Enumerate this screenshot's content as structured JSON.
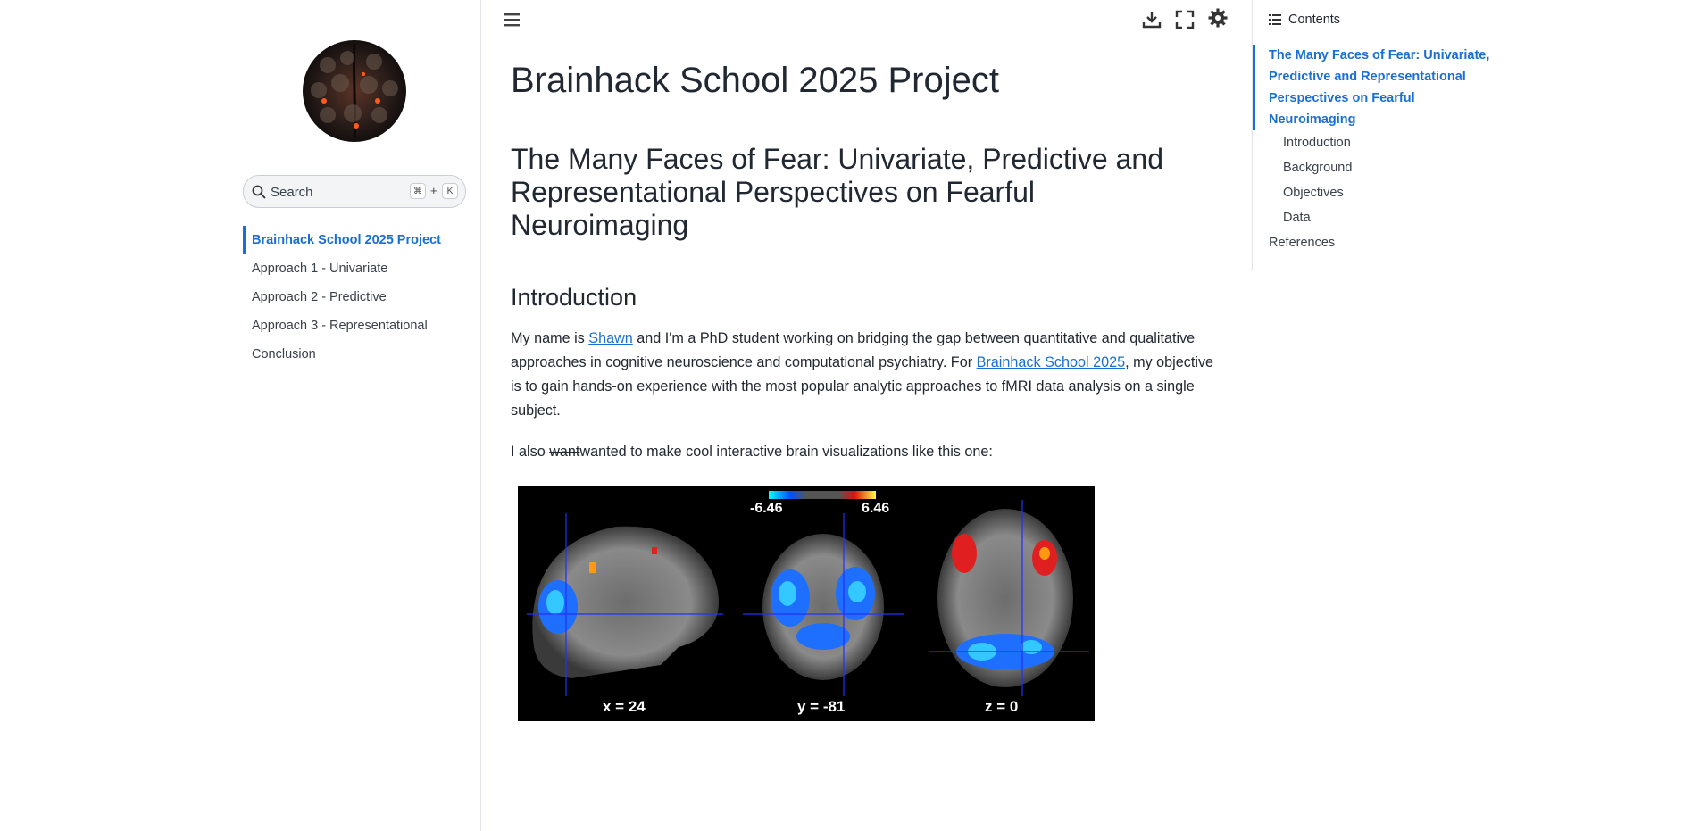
{
  "sidebar": {
    "search": {
      "placeholder": "Search",
      "shortcut_mod": "⌘",
      "shortcut_plus": "+",
      "shortcut_key": "K"
    },
    "items": [
      {
        "label": "Brainhack School 2025 Project",
        "active": true
      },
      {
        "label": "Approach 1 - Univariate"
      },
      {
        "label": "Approach 2 - Predictive"
      },
      {
        "label": "Approach 3 - Representational"
      },
      {
        "label": "Conclusion"
      }
    ]
  },
  "header": {
    "icons": [
      "menu-icon",
      "download-icon",
      "fullscreen-icon",
      "theme-gear-icon"
    ]
  },
  "main": {
    "title": "Brainhack School 2025 Project",
    "subtitle": "The Many Faces of Fear: Univariate, Predictive and Representational Perspectives on Fearful Neuroimaging",
    "intro_heading": "Introduction",
    "para1": {
      "t1": "My name is ",
      "link1": "Shawn",
      "t2": " and I'm a PhD student working on bridging the gap between quantitative and qualitative approaches in cognitive neuroscience and computational psychiatry. For ",
      "link2": "Brainhack School 2025",
      "t3": ", my objective is to gain hands-on experience with the most popular analytic approaches to fMRI data analysis on a single subject."
    },
    "para2": {
      "t1": "I also ",
      "strike": "want",
      "t2": "wanted to make cool interactive brain visualizations like this one:"
    },
    "figure": {
      "colorbar_min": "-6.46",
      "colorbar_max": "6.46",
      "captions": [
        "x = 24",
        "y = -81",
        "z = 0"
      ]
    }
  },
  "toc": {
    "heading": "Contents",
    "active": "The Many Faces of Fear: Univariate, Predictive and Representational Perspectives on Fearful Neuroimaging",
    "subitems": [
      "Introduction",
      "Background",
      "Objectives",
      "Data"
    ],
    "top_items": [
      "References"
    ]
  },
  "colors": {
    "accent": "#1a6fd3",
    "text": "#222832",
    "muted": "#3a414b"
  }
}
